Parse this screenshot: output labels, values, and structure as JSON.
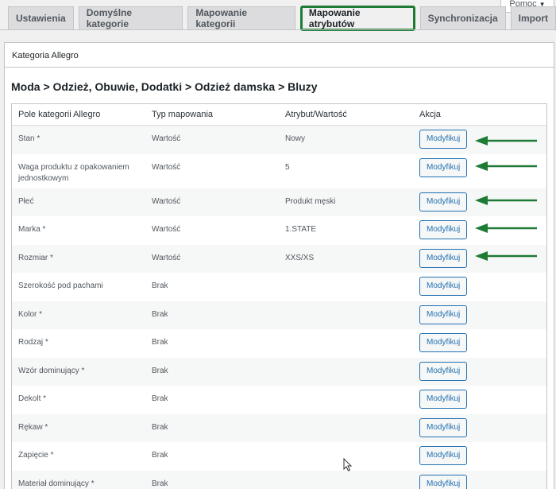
{
  "help": {
    "label": "Pomoc"
  },
  "tabs": [
    {
      "label": "Ustawienia"
    },
    {
      "label": "Domyślne kategorie"
    },
    {
      "label": "Mapowanie kategorii"
    },
    {
      "label": "Mapowanie atrybutów"
    },
    {
      "label": "Synchronizacja"
    },
    {
      "label": "Import"
    }
  ],
  "panel": {
    "header": "Kategoria Allegro",
    "breadcrumb": "Moda > Odzież, Obuwie, Dodatki > Odzież damska > Bluzy"
  },
  "table": {
    "columns": [
      "Pole kategorii Allegro",
      "Typ mapowania",
      "Atrybut/Wartość",
      "Akcja"
    ],
    "rows": [
      {
        "field": "Stan *",
        "type": "Wartość",
        "value": "Nowy",
        "action": "Modyfikuj"
      },
      {
        "field": "Waga produktu z opakowaniem jednostkowym",
        "type": "Wartość",
        "value": "5",
        "action": "Modyfikuj"
      },
      {
        "field": "Płeć",
        "type": "Wartość",
        "value": "Produkt męski",
        "action": "Modyfikuj"
      },
      {
        "field": "Marka *",
        "type": "Wartość",
        "value": "1.STATE",
        "action": "Modyfikuj"
      },
      {
        "field": "Rozmiar *",
        "type": "Wartość",
        "value": "XXS/XS",
        "action": "Modyfikuj"
      },
      {
        "field": "Szerokość pod pachami",
        "type": "Brak",
        "value": "",
        "action": "Modyfikuj"
      },
      {
        "field": "Kolor *",
        "type": "Brak",
        "value": "",
        "action": "Modyfikuj"
      },
      {
        "field": "Rodzaj *",
        "type": "Brak",
        "value": "",
        "action": "Modyfikuj"
      },
      {
        "field": "Wzór dominujący *",
        "type": "Brak",
        "value": "",
        "action": "Modyfikuj"
      },
      {
        "field": "Dekolt *",
        "type": "Brak",
        "value": "",
        "action": "Modyfikuj"
      },
      {
        "field": "Rękaw *",
        "type": "Brak",
        "value": "",
        "action": "Modyfikuj"
      },
      {
        "field": "Zapięcie *",
        "type": "Brak",
        "value": "",
        "action": "Modyfikuj"
      },
      {
        "field": "Materiał dominujący *",
        "type": "Brak",
        "value": "",
        "action": "Modyfikuj"
      }
    ]
  },
  "colors": {
    "active_tab_outline": "#1e7b35",
    "arrow": "#1e7b35",
    "button": "#2271b1"
  }
}
